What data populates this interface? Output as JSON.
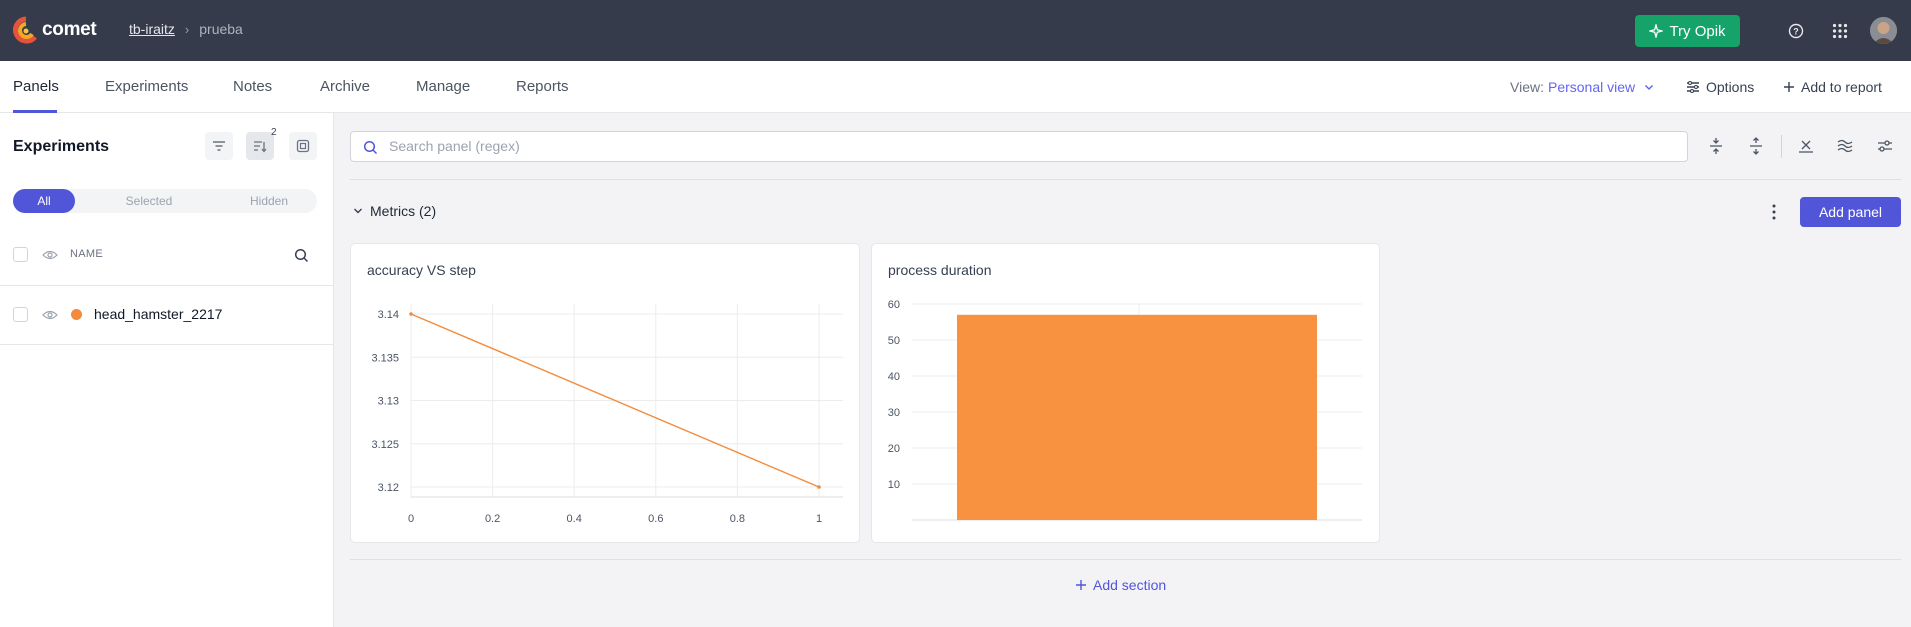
{
  "app": {
    "brand": "comet",
    "workspace": "tb-iraitz",
    "project": "prueba",
    "try_opik": "Try Opik"
  },
  "tabs": [
    {
      "label": "Panels",
      "active": true
    },
    {
      "label": "Experiments"
    },
    {
      "label": "Notes"
    },
    {
      "label": "Archive"
    },
    {
      "label": "Manage"
    },
    {
      "label": "Reports"
    }
  ],
  "toolbar": {
    "view_label": "View:",
    "view_value": "Personal view",
    "options": "Options",
    "add_to_report": "Add to report"
  },
  "sidebar": {
    "title": "Experiments",
    "sort_badge": "2",
    "filters": [
      "All",
      "Selected",
      "Hidden"
    ],
    "column_name": "NAME",
    "experiments": [
      {
        "name": "head_hamster_2217",
        "color": "#f48b3a"
      }
    ]
  },
  "main": {
    "search_placeholder": "Search panel (regex)",
    "section_title": "Metrics (2)",
    "add_panel": "Add panel",
    "add_section": "Add section"
  },
  "chart_data": [
    {
      "type": "line",
      "title": "accuracy VS step",
      "x": [
        0,
        1
      ],
      "series": [
        {
          "values": [
            3.14,
            3.12
          ],
          "color": "#f48b3a"
        }
      ],
      "xticks": [
        "0",
        "0.2",
        "0.4",
        "0.6",
        "0.8",
        "1"
      ],
      "yticks": [
        "3.14",
        "3.135",
        "3.13",
        "3.125",
        "3.12"
      ],
      "xlim": [
        0,
        1
      ],
      "ylim": [
        3.12,
        3.14
      ],
      "grid": true
    },
    {
      "type": "bar",
      "title": "process duration",
      "categories": [
        ""
      ],
      "values": [
        57
      ],
      "color": "#f89240",
      "yticks": [
        "60",
        "50",
        "40",
        "30",
        "20",
        "10"
      ],
      "ylim": [
        0,
        60
      ],
      "grid": true
    }
  ]
}
